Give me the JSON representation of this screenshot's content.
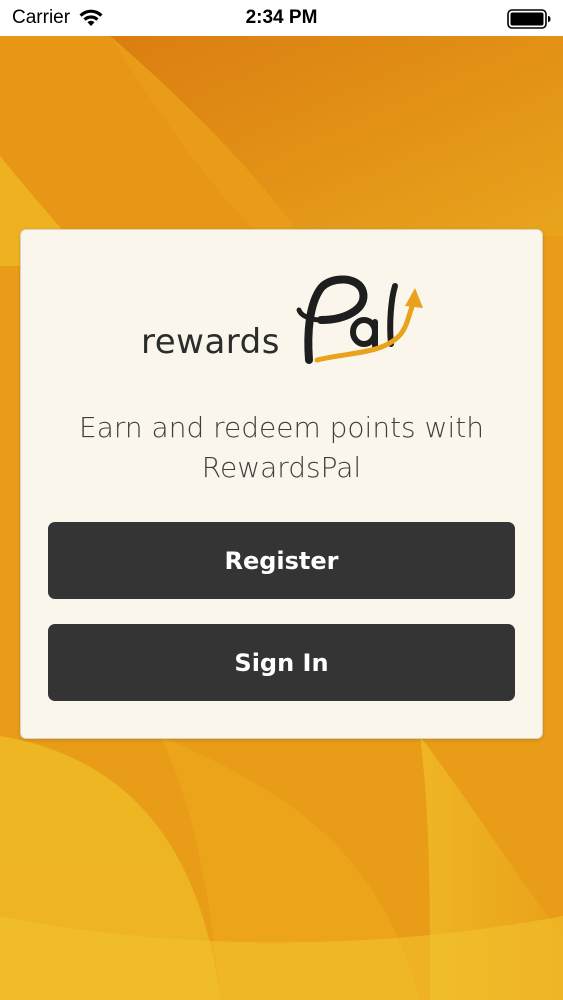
{
  "status_bar": {
    "carrier": "Carrier",
    "time": "2:34 PM",
    "wifi_icon": "wifi-icon",
    "battery_icon": "battery-icon"
  },
  "brand": {
    "logo_word": "rewards",
    "logo_script": "Pal",
    "accent_color": "#e8a21b",
    "arrow_icon": "up-arrow-icon"
  },
  "welcome": {
    "tagline_line1": "Earn and redeem points with",
    "tagline_line2": "RewardsPal"
  },
  "actions": {
    "register_label": "Register",
    "signin_label": "Sign In",
    "button_color": "#343434"
  },
  "theme": {
    "background_color": "#e89a18",
    "card_color": "#fbf6ec"
  }
}
